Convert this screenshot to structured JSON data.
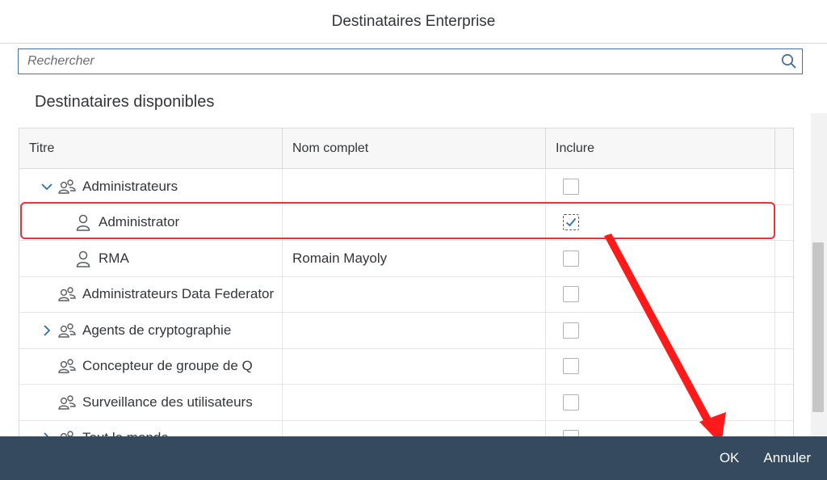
{
  "dialog": {
    "title": "Destinataires Enterprise"
  },
  "search": {
    "placeholder": "Rechercher",
    "value": ""
  },
  "section_title": "Destinataires disponibles",
  "table": {
    "columns": [
      "Titre",
      "Nom complet",
      "Inclure"
    ],
    "rows": [
      {
        "title": "Administrateurs",
        "full_name": "",
        "kind": "group",
        "expander": "expanded",
        "indent": 0,
        "checked": false
      },
      {
        "title": "Administrator",
        "full_name": "",
        "kind": "user",
        "expander": "none",
        "indent": 1,
        "checked": true
      },
      {
        "title": "RMA",
        "full_name": "Romain Mayoly",
        "kind": "user",
        "expander": "none",
        "indent": 1,
        "checked": false
      },
      {
        "title": "Administrateurs Data Federator",
        "full_name": "",
        "kind": "group",
        "expander": "none",
        "indent": 0,
        "checked": false
      },
      {
        "title": "Agents de cryptographie",
        "full_name": "",
        "kind": "group",
        "expander": "collapsed",
        "indent": 0,
        "checked": false
      },
      {
        "title": "Concepteur de groupe de Q",
        "full_name": "",
        "kind": "group",
        "expander": "none",
        "indent": 0,
        "checked": false
      },
      {
        "title": "Surveillance des utilisateurs",
        "full_name": "",
        "kind": "group",
        "expander": "none",
        "indent": 0,
        "checked": false
      },
      {
        "title": "Tout le monde",
        "full_name": "",
        "kind": "group",
        "expander": "collapsed",
        "indent": 0,
        "checked": false
      }
    ]
  },
  "footer": {
    "ok_label": "OK",
    "cancel_label": "Annuler"
  },
  "colors": {
    "footer_bg": "#354a5f",
    "highlight": "#e5323c",
    "arrow": "#ff1a1a",
    "search_border": "#4a6fa5"
  }
}
